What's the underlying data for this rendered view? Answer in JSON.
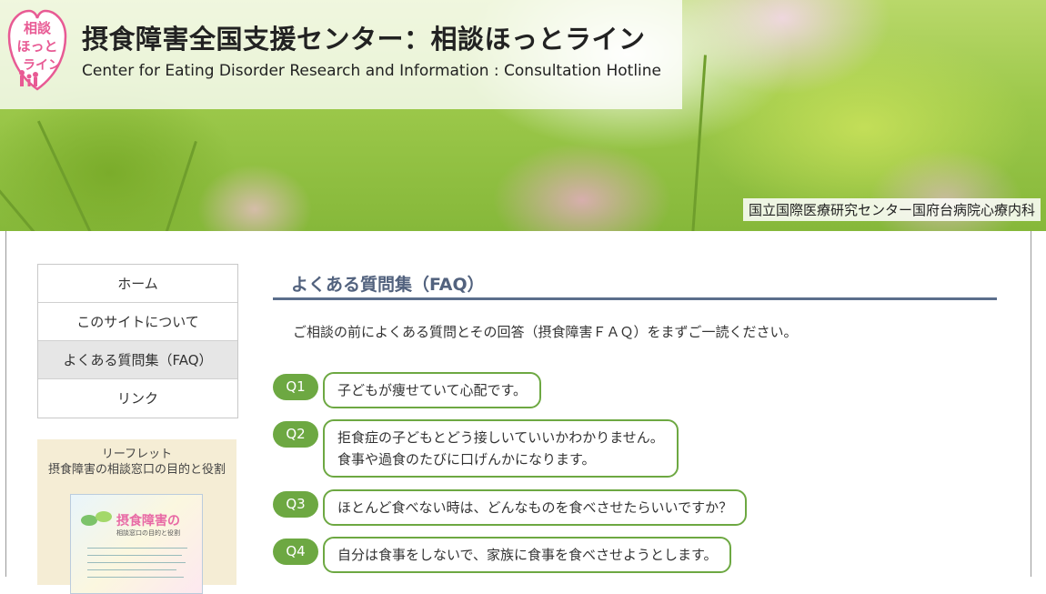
{
  "header": {
    "logo_text": "相談ほっとライン",
    "title_ja": "摂食障害全国支援センター：相談ほっとライン",
    "title_en": "Center for Eating Disorder Research and Information : Consultation Hotline",
    "affiliation": "国立国際医療研究センター国府台病院心療内科"
  },
  "sidebar": {
    "nav": [
      {
        "label": "ホーム"
      },
      {
        "label": "このサイトについて"
      },
      {
        "label": "よくある質問集（FAQ）",
        "active": true
      },
      {
        "label": "リンク"
      }
    ],
    "leaflet": {
      "label": "リーフレット",
      "subtitle": "摂食障害の相談窓口の目的と役割",
      "thumb_title": "摂食障害の",
      "thumb_sub": "相談窓口の目的と役割"
    }
  },
  "main": {
    "heading": "よくある質問集（FAQ）",
    "intro": "ご相談の前によくある質問とその回答（摂食障害ＦＡＱ）をまずご一読ください。",
    "faqs": [
      {
        "q": "Q1",
        "lines": [
          "子どもが痩せていて心配です。"
        ]
      },
      {
        "q": "Q2",
        "lines": [
          "拒食症の子どもとどう接しいていいかわかりません。",
          "食事や過食のたびに口げんかになります。"
        ]
      },
      {
        "q": "Q3",
        "lines": [
          "ほとんど食べない時は、どんなものを食べさせたらいいですか？"
        ]
      },
      {
        "q": "Q4",
        "lines": [
          "自分は食事をしないで、家族に食事を食べさせようとします。"
        ]
      }
    ]
  },
  "colors": {
    "accent_green": "#6da842",
    "heading_blue": "#52627e",
    "leaflet_bg": "#f5edd5",
    "logo_pink": "#e85a94"
  }
}
